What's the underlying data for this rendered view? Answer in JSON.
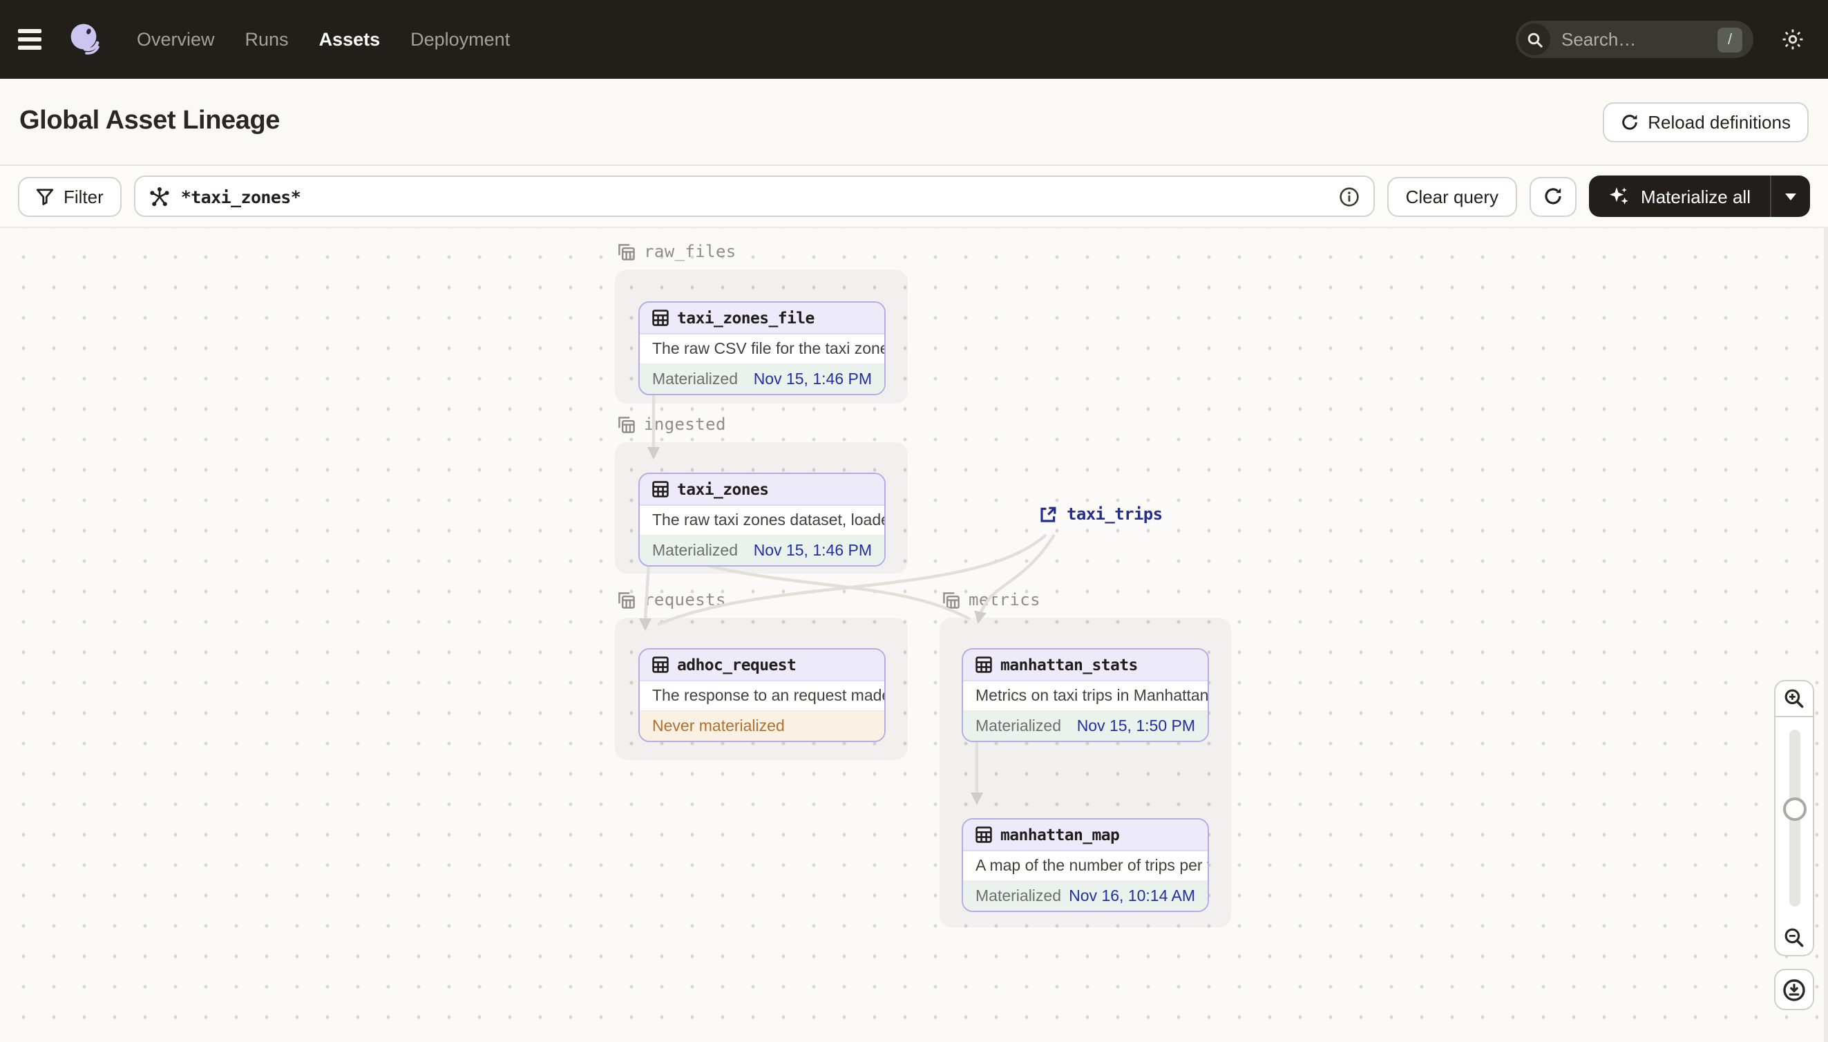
{
  "nav": {
    "items": [
      {
        "label": "Overview",
        "active": false
      },
      {
        "label": "Runs",
        "active": false
      },
      {
        "label": "Assets",
        "active": true
      },
      {
        "label": "Deployment",
        "active": false
      }
    ],
    "search": {
      "placeholder": "Search…",
      "shortcut": "/"
    }
  },
  "header": {
    "title": "Global Asset Lineage",
    "reload_label": "Reload definitions"
  },
  "toolbar": {
    "filter_label": "Filter",
    "query_value": "*taxi_zones*",
    "clear_query_label": "Clear query",
    "materialize_label": "Materialize all"
  },
  "graph": {
    "groups": [
      {
        "name": "raw_files"
      },
      {
        "name": "ingested"
      },
      {
        "name": "requests"
      },
      {
        "name": "metrics"
      }
    ],
    "nodes": [
      {
        "id": "taxi_zones_file",
        "group": "raw_files",
        "description": "The raw CSV file for the taxi zones dat…",
        "status": "Materialized",
        "timestamp": "Nov 15, 1:46 PM"
      },
      {
        "id": "taxi_zones",
        "group": "ingested",
        "description": "The raw taxi zones dataset, loaded int…",
        "status": "Materialized",
        "timestamp": "Nov 15, 1:46 PM"
      },
      {
        "id": "adhoc_request",
        "group": "requests",
        "description": "The response to an request made in th…",
        "status": "Never materialized",
        "timestamp": ""
      },
      {
        "id": "manhattan_stats",
        "group": "metrics",
        "description": "Metrics on taxi trips in Manhattan",
        "status": "Materialized",
        "timestamp": "Nov 15, 1:50 PM"
      },
      {
        "id": "manhattan_map",
        "group": "metrics",
        "description": "A map of the number of trips per taxi z…",
        "status": "Materialized",
        "timestamp": "Nov 16, 10:14 AM"
      }
    ],
    "external_assets": [
      {
        "id": "taxi_trips"
      }
    ],
    "edges": [
      {
        "from": "taxi_zones_file",
        "to": "taxi_zones"
      },
      {
        "from": "taxi_zones",
        "to": "adhoc_request"
      },
      {
        "from": "taxi_zones",
        "to": "manhattan_stats"
      },
      {
        "from": "taxi_trips",
        "to": "adhoc_request"
      },
      {
        "from": "taxi_trips",
        "to": "manhattan_stats"
      },
      {
        "from": "manhattan_stats",
        "to": "manhattan_map"
      }
    ]
  },
  "colors": {
    "nav_bg": "#221F1B",
    "accent_lavender_border": "#B5ABE6",
    "node_header_bg": "#EDEAF9",
    "materialized_bg": "#E9F2EC",
    "materialized_time": "#222FA0",
    "never_materialized_bg": "#FAF1E4",
    "never_materialized_text": "#B06F2D",
    "external_asset_text": "#232E8E",
    "edge": "#E2DFDB"
  }
}
